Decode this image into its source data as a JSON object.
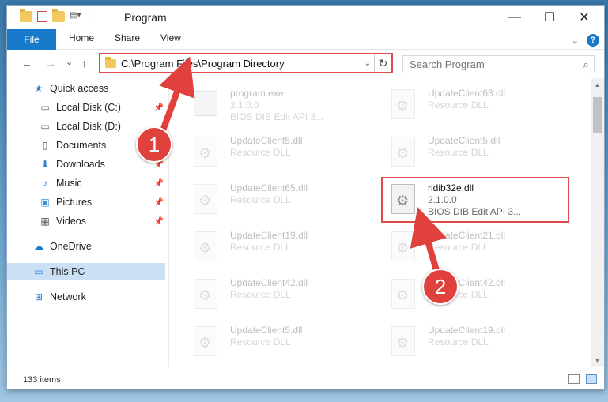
{
  "window": {
    "title": "Program",
    "controls": {
      "minimize": "—",
      "maximize": "☐",
      "close": "✕"
    }
  },
  "ribbon": {
    "tabs": [
      "File",
      "Home",
      "Share",
      "View"
    ],
    "expand_icon": "chevron-down-icon",
    "help_icon": "?"
  },
  "nav": {
    "back": "←",
    "forward": "→",
    "recent": "⌄",
    "up": "↑",
    "address": "C:\\Program Files\\Program Directory",
    "dropdown": "⌄",
    "refresh": "↻",
    "search_placeholder": "Search Program",
    "search_icon": "⌕"
  },
  "sidebar": {
    "items": [
      {
        "label": "Quick access",
        "icon": "star-icon",
        "pinned": false
      },
      {
        "label": "Local Disk (C:)",
        "icon": "drive-icon",
        "pinned": true
      },
      {
        "label": "Local Disk (D:)",
        "icon": "drive-icon",
        "pinned": false
      },
      {
        "label": "Documents",
        "icon": "documents-icon",
        "pinned": true
      },
      {
        "label": "Downloads",
        "icon": "downloads-icon",
        "pinned": true
      },
      {
        "label": "Music",
        "icon": "music-icon",
        "pinned": true
      },
      {
        "label": "Pictures",
        "icon": "pictures-icon",
        "pinned": true
      },
      {
        "label": "Videos",
        "icon": "videos-icon",
        "pinned": true
      },
      {
        "label": "OneDrive",
        "icon": "cloud-icon",
        "pinned": false
      },
      {
        "label": "This PC",
        "icon": "computer-icon",
        "pinned": false,
        "selected": true
      },
      {
        "label": "Network",
        "icon": "network-icon",
        "pinned": false
      }
    ]
  },
  "files": [
    {
      "name": "program.exe",
      "line2": "2.1.0.0",
      "line3": "BIOS DIB Edit API 3...",
      "faded": true
    },
    {
      "name": "UpdateClient63.dll",
      "line2": "Resource DLL",
      "faded": true
    },
    {
      "name": "UpdateClient5.dll",
      "line2": "Resource DLL",
      "faded": true
    },
    {
      "name": "UpdateClient5.dll",
      "line2": "Resource DLL",
      "faded": true
    },
    {
      "name": "UpdateClient65.dll",
      "line2": "Resource DLL",
      "faded": true
    },
    {
      "name": "ridib32e.dll",
      "line2": "2.1.0.0",
      "line3": "BIOS DIB Edit API 3...",
      "faded": false
    },
    {
      "name": "UpdateClient19.dll",
      "line2": "Resource DLL",
      "faded": true
    },
    {
      "name": "UpdateClient21.dll",
      "line2": "Resource DLL",
      "faded": true
    },
    {
      "name": "UpdateClient42.dll",
      "line2": "Resource DLL",
      "faded": true
    },
    {
      "name": "UpdateClient42.dll",
      "line2": "Resource DLL",
      "faded": true
    },
    {
      "name": "UpdateClient5.dll",
      "line2": "Resource DLL",
      "faded": true
    },
    {
      "name": "UpdateClient19.dll",
      "line2": "Resource DLL",
      "faded": true
    }
  ],
  "status": {
    "count": "133 items"
  },
  "annotations": {
    "marker1": "1",
    "marker2": "2"
  },
  "colors": {
    "accent": "#1979ca",
    "highlight": "#e04a4a",
    "selected": "#cce0f5"
  }
}
